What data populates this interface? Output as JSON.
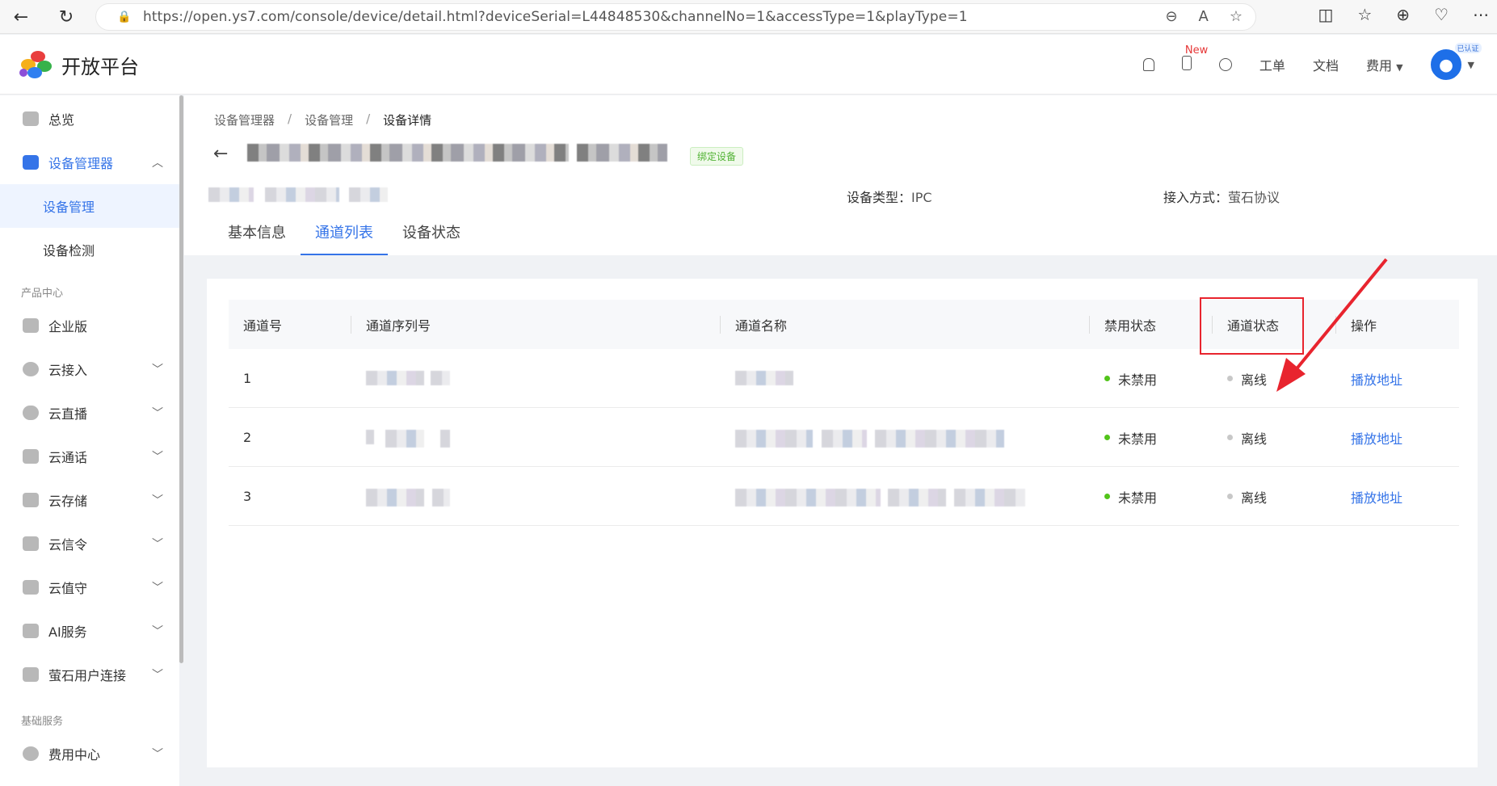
{
  "browser": {
    "url": "https://open.ys7.com/console/device/detail.html?deviceSerial=L44848530&channelNo=1&accessType=1&playType=1"
  },
  "header": {
    "logo_text": "开放平台",
    "new_badge": "New",
    "ticket": "工单",
    "docs": "文档",
    "fees": "费用",
    "verified": "已认证"
  },
  "sidebar": {
    "overview": "总览",
    "device_manager": "设备管理器",
    "device_management": "设备管理",
    "device_detection": "设备检测",
    "group_product": "产品中心",
    "enterprise": "企业版",
    "cloud_access": "云接入",
    "cloud_live": "云直播",
    "cloud_call": "云通话",
    "cloud_storage": "云存储",
    "cloud_signal": "云信令",
    "cloud_guard": "云值守",
    "ai_service": "AI服务",
    "user_connect": "萤石用户连接",
    "group_basic": "基础服务",
    "billing": "费用中心"
  },
  "breadcrumb": [
    "设备管理器",
    "设备管理",
    "设备详情"
  ],
  "device": {
    "bind_tag": "绑定设备",
    "type_label": "设备类型：",
    "type_value": "IPC",
    "access_label": "接入方式：",
    "access_value": "萤石协议"
  },
  "tabs": [
    "基本信息",
    "通道列表",
    "设备状态"
  ],
  "table": {
    "headers": [
      "通道号",
      "通道序列号",
      "通道名称",
      "禁用状态",
      "通道状态",
      "操作"
    ],
    "rows": [
      {
        "no": "1",
        "disable": "未禁用",
        "status": "离线",
        "action": "播放地址"
      },
      {
        "no": "2",
        "disable": "未禁用",
        "status": "离线",
        "action": "播放地址"
      },
      {
        "no": "3",
        "disable": "未禁用",
        "status": "离线",
        "action": "播放地址"
      }
    ]
  },
  "colors": {
    "primary": "#3574e8",
    "enabled_dot": "#52c41a",
    "offline_dot": "#c8c8c8",
    "annotation": "#e8242e"
  }
}
